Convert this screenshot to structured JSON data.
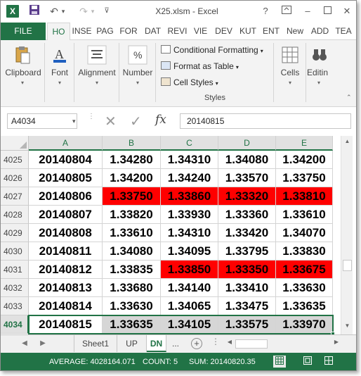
{
  "window": {
    "title": "X25.xlsm - Excel",
    "app_icon": "X"
  },
  "quick_access": {
    "save_icon": "save-icon",
    "undo_icon": "undo-icon",
    "redo_icon": "redo-icon"
  },
  "window_controls": {
    "help": "?"
  },
  "tabs": [
    {
      "label": "FILE"
    },
    {
      "label": "HO"
    },
    {
      "label": "INSE"
    },
    {
      "label": "PAG"
    },
    {
      "label": "FOR"
    },
    {
      "label": "DAT"
    },
    {
      "label": "REVI"
    },
    {
      "label": "VIE"
    },
    {
      "label": "DEV"
    },
    {
      "label": "KUT"
    },
    {
      "label": "ENT"
    },
    {
      "label": "New"
    },
    {
      "label": "ADD"
    },
    {
      "label": "TEA"
    }
  ],
  "ribbon": {
    "clipboard": "Clipboard",
    "font": "Font",
    "alignment": "Alignment",
    "number": "Number",
    "conditional_formatting": "Conditional Formatting",
    "format_as_table": "Format as Table",
    "cell_styles": "Cell Styles",
    "styles_group": "Styles",
    "cells": "Cells",
    "editing": "Editin",
    "number_icon_glyph": "%"
  },
  "formula_bar": {
    "name_box": "A4034",
    "fx": "fx",
    "value": "20140815"
  },
  "columns": [
    "A",
    "B",
    "C",
    "D",
    "E"
  ],
  "rows": [
    {
      "num": "4025",
      "cells": [
        "20140804",
        "1.34280",
        "1.34310",
        "1.34080",
        "1.34200"
      ],
      "red": []
    },
    {
      "num": "4026",
      "cells": [
        "20140805",
        "1.34200",
        "1.34240",
        "1.33570",
        "1.33750"
      ],
      "red": []
    },
    {
      "num": "4027",
      "cells": [
        "20140806",
        "1.33750",
        "1.33860",
        "1.33320",
        "1.33810"
      ],
      "red": [
        1,
        2,
        3,
        4
      ]
    },
    {
      "num": "4028",
      "cells": [
        "20140807",
        "1.33820",
        "1.33930",
        "1.33360",
        "1.33610"
      ],
      "red": []
    },
    {
      "num": "4029",
      "cells": [
        "20140808",
        "1.33610",
        "1.34310",
        "1.33420",
        "1.34070"
      ],
      "red": []
    },
    {
      "num": "4030",
      "cells": [
        "20140811",
        "1.34080",
        "1.34095",
        "1.33795",
        "1.33830"
      ],
      "red": []
    },
    {
      "num": "4031",
      "cells": [
        "20140812",
        "1.33835",
        "1.33850",
        "1.33350",
        "1.33675"
      ],
      "red": [
        2,
        3,
        4
      ]
    },
    {
      "num": "4032",
      "cells": [
        "20140813",
        "1.33680",
        "1.34140",
        "1.33410",
        "1.33630"
      ],
      "red": []
    },
    {
      "num": "4033",
      "cells": [
        "20140814",
        "1.33630",
        "1.34065",
        "1.33475",
        "1.33635"
      ],
      "red": []
    },
    {
      "num": "4034",
      "cells": [
        "20140815",
        "1.33635",
        "1.34105",
        "1.33575",
        "1.33970"
      ],
      "red": [],
      "selected": true
    }
  ],
  "colors": {
    "excel_green": "#217346",
    "highlight_red": "#ff0000"
  },
  "sheets": {
    "tabs": [
      "Sheet1",
      "UP",
      "DN"
    ],
    "active": "DN",
    "more": "..."
  },
  "status": {
    "average": "AVERAGE: 4028164.071",
    "count": "COUNT: 5",
    "sum": "SUM: 20140820.35"
  }
}
